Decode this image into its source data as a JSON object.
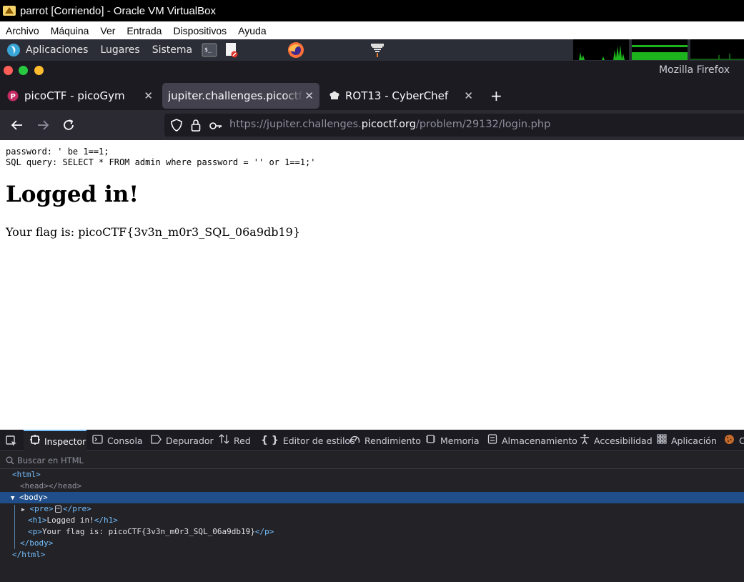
{
  "virtualbox": {
    "title": "parrot [Corriendo] - Oracle VM VirtualBox",
    "menu": [
      "Archivo",
      "Máquina",
      "Ver",
      "Entrada",
      "Dispositivos",
      "Ayuda"
    ]
  },
  "panel": {
    "items": [
      "Aplicaciones",
      "Lugares",
      "Sistema"
    ],
    "launcher_icons": [
      "terminal-icon",
      "text-editor-icon",
      "firefox-icon",
      "burp-icon"
    ]
  },
  "firefox": {
    "window_title": "Mozilla Firefox",
    "tabs": [
      {
        "label": "picoCTF - picoGym",
        "active": false,
        "icon": "picoctf-icon"
      },
      {
        "label": "jupiter.challenges.picoctf.org",
        "active": true
      },
      {
        "label": "ROT13 - CyberChef",
        "active": false,
        "icon": "chef-hat-icon"
      }
    ],
    "url": {
      "prefix": "https://jupiter.challenges.",
      "domain": "picoctf.org",
      "suffix": "/problem/29132/login.php"
    }
  },
  "page": {
    "pre_line1": "password: ' be 1==1;",
    "pre_line2": "SQL query: SELECT * FROM admin where password = '' or 1==1;'",
    "heading": "Logged in!",
    "flag_text": "Your flag is: picoCTF{3v3n_m0r3_SQL_06a9db19}"
  },
  "devtools": {
    "tabs": [
      "Inspector",
      "Consola",
      "Depurador",
      "Red",
      "Editor de estilos",
      "Rendimiento",
      "Memoria",
      "Almacenamiento",
      "Accesibilidad",
      "Aplicación",
      "C"
    ],
    "search_placeholder": "Buscar en HTML",
    "tree": {
      "html_open": "html",
      "head": "<head></head>",
      "body_open": "body",
      "pre": "pre",
      "h1_text": "Logged in!",
      "p_text": "Your flag is: picoCTF{3v3n_m0r3_SQL_06a9db19}",
      "body_close": "/body",
      "html_close": "/html"
    }
  },
  "colors": {
    "accent": "#75bfff",
    "selection": "#204e8a",
    "close_dot": "#ff5f57",
    "max_dot": "#28c840",
    "min_dot": "#febc2e"
  }
}
